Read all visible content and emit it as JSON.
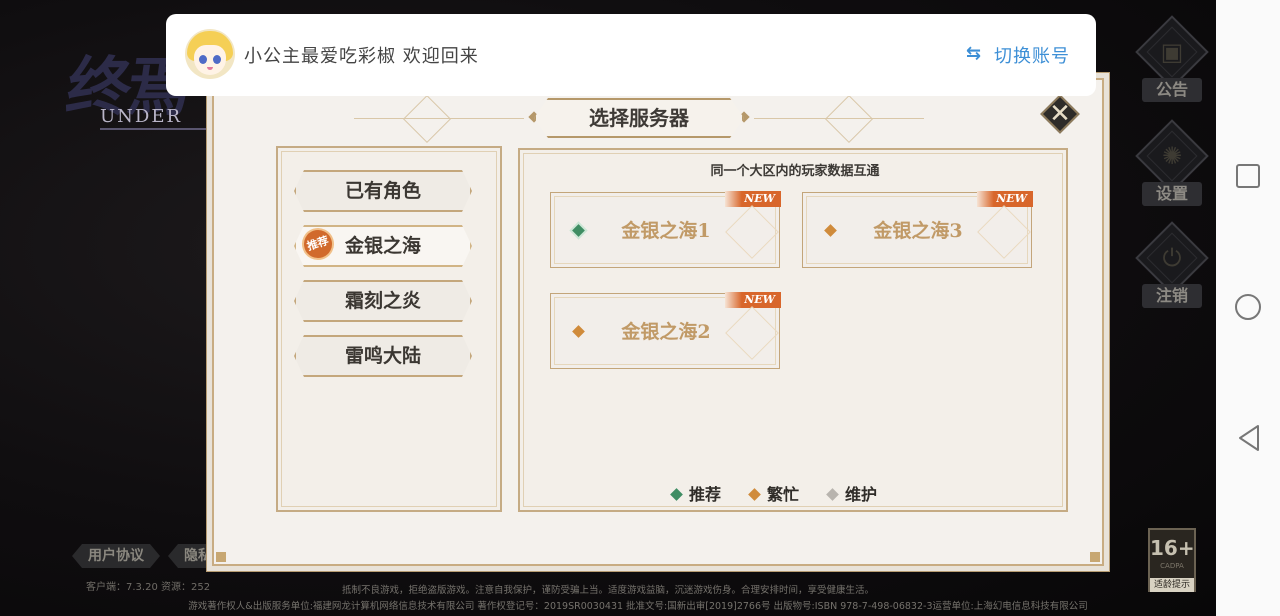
{
  "logo": {
    "title": "终焉",
    "subtitle": "UNDER"
  },
  "welcome": {
    "message": "小公主最爱吃彩椒 欢迎回来",
    "switch_label": "切换账号"
  },
  "side_menu": [
    {
      "label": "公告",
      "icon": "notice-icon"
    },
    {
      "label": "设置",
      "icon": "gear-icon"
    },
    {
      "label": "注销",
      "icon": "power-icon"
    }
  ],
  "dialog": {
    "title": "选择服务器",
    "regions": [
      {
        "label": "已有角色"
      },
      {
        "label": "金银之海",
        "badge": "推荐",
        "active": true
      },
      {
        "label": "霜刻之炎"
      },
      {
        "label": "雷鸣大陆"
      }
    ],
    "note": "同一个大区内的玩家数据互通",
    "servers": [
      {
        "name": "金银之海1",
        "status": "推荐",
        "tag": "NEW"
      },
      {
        "name": "金银之海3",
        "status": "繁忙",
        "tag": "NEW"
      },
      {
        "name": "金银之海2",
        "status": "繁忙",
        "tag": "NEW"
      }
    ],
    "legend": [
      {
        "label": "推荐",
        "color": "#3f8d63"
      },
      {
        "label": "繁忙",
        "color": "#d08b3b"
      },
      {
        "label": "维护",
        "color": "#b8b4ae"
      }
    ]
  },
  "bottom_links": {
    "user_agreement": "用户协议",
    "privacy": "隐私"
  },
  "version": "客户端：7.3.20 资源：252",
  "footer": {
    "line1": "抵制不良游戏，拒绝盗版游戏。注意自我保护，谨防受骗上当。适度游戏益脑，沉迷游戏伤身。合理安排时间，享受健康生活。",
    "line2": "游戏著作权人&出版服务单位:福建网龙计算机网络信息技术有限公司 著作权登记号：2019SR0030431 批准文号:国新出审[2019]2766号 出版物号:ISBN 978-7-498-06832-3运营单位:上海幻电信息科技有限公司"
  },
  "age_rating": {
    "value": "16+",
    "org": "CADPA",
    "tip": "适龄提示"
  }
}
